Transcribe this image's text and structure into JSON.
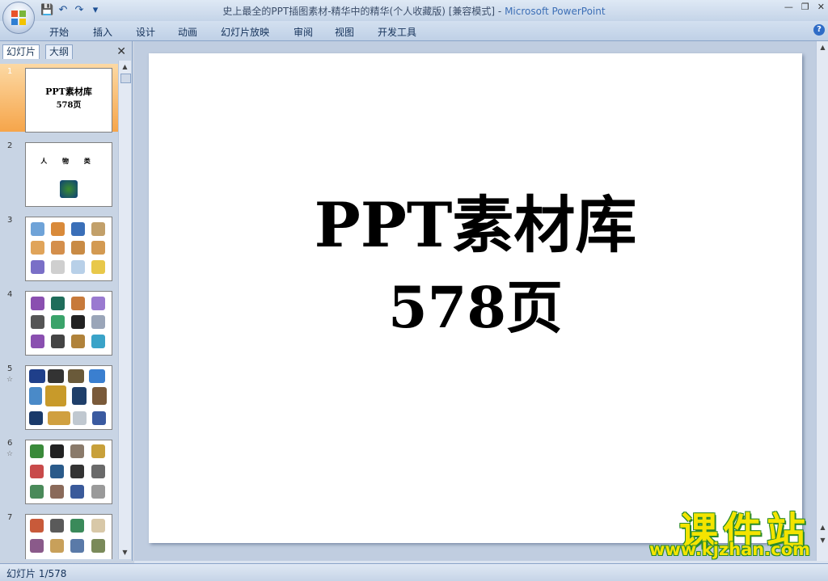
{
  "window": {
    "title_doc": "史上最全的PPT插图素材-精华中的精华(个人收藏版) [兼容模式] - ",
    "title_app": "Microsoft PowerPoint"
  },
  "quick_access": [
    "save-icon",
    "undo-icon",
    "redo-icon",
    "customize-icon"
  ],
  "ribbon": {
    "tabs": [
      "开始",
      "插入",
      "设计",
      "动画",
      "幻灯片放映",
      "审阅",
      "视图",
      "开发工具"
    ]
  },
  "slides_panel": {
    "tab_slides": "幻灯片",
    "tab_outline": "大纲",
    "slides": [
      {
        "number": "1",
        "title": "PPT素材库",
        "subtitle": "578页"
      },
      {
        "number": "2",
        "title": "人 物 类"
      },
      {
        "number": "3"
      },
      {
        "number": "4"
      },
      {
        "number": "5"
      },
      {
        "number": "6"
      },
      {
        "number": "7"
      }
    ]
  },
  "slide": {
    "title": "PPT素材库",
    "subtitle": "578页"
  },
  "status": {
    "text": "幻灯片 1/578"
  },
  "watermark": {
    "line1": "课件站",
    "line2": "www.kjzhan.com"
  },
  "colors": {
    "selected_thumb": "#f6a54a",
    "app_title": "#3d6fb6",
    "watermark_fill": "#f4e400",
    "watermark_outline": "#2a8a2a"
  }
}
